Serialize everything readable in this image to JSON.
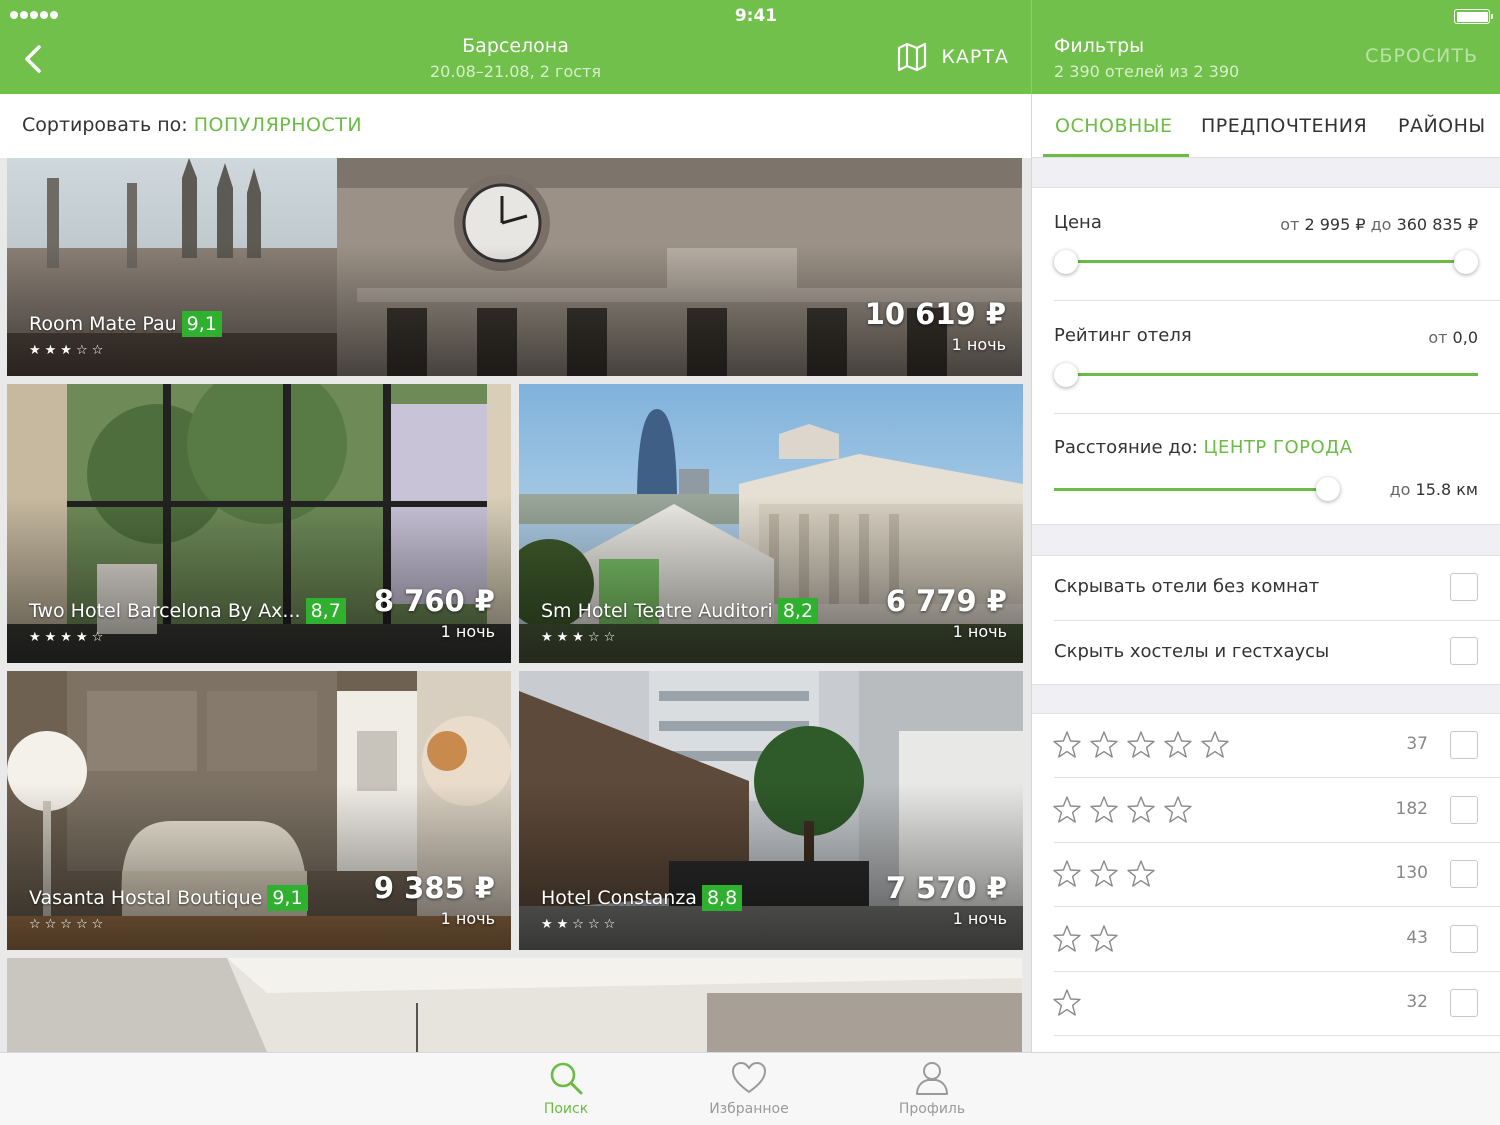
{
  "status": {
    "time": "9:41"
  },
  "header": {
    "city": "Барселона",
    "dates": "20.08–21.08, 2 гостя",
    "map_label": "КАРТА"
  },
  "filters_header": {
    "title": "Фильтры",
    "subtitle": "2 390 отелей из 2 390",
    "reset_label": "СБРОСИТЬ"
  },
  "sort": {
    "label": "Сортировать по:",
    "value": "ПОПУЛЯРНОСТИ"
  },
  "hotels": [
    {
      "name": "Room Mate Pau",
      "rating": "9,1",
      "stars": "★★★☆☆",
      "price": "10 619 ₽",
      "per": "1 ночь"
    },
    {
      "name": "Two Hotel Barcelona By Ax...",
      "rating": "8,7",
      "stars": "★★★★☆",
      "price": "8 760 ₽",
      "per": "1 ночь"
    },
    {
      "name": "Sm Hotel Teatre Auditori",
      "rating": "8,2",
      "stars": "★★★☆☆",
      "price": "6 779 ₽",
      "per": "1 ночь"
    },
    {
      "name": "Vasanta Hostal Boutique",
      "rating": "9,1",
      "stars": "☆☆☆☆☆",
      "price": "9 385 ₽",
      "per": "1 ночь"
    },
    {
      "name": "Hotel Constanza",
      "rating": "8,8",
      "stars": "★★☆☆☆",
      "price": "7 570 ₽",
      "per": "1 ночь"
    }
  ],
  "filter_tabs": {
    "main": "ОСНОВНЫЕ",
    "prefs": "ПРЕДПОЧТЕНИЯ",
    "districts": "РАЙОНЫ"
  },
  "price_filter": {
    "label": "Цена",
    "from_word": "от",
    "from": "2 995 ₽",
    "to_word": "до",
    "to": "360 835 ₽",
    "min_fraction": 0.0,
    "max_fraction": 1.0
  },
  "rating_filter": {
    "label": "Рейтинг отеля",
    "from_word": "от",
    "value": "0,0",
    "fraction": 0.0
  },
  "distance_filter": {
    "label": "Расстояние до:",
    "target": "ЦЕНТР ГОРОДА",
    "to_word": "до",
    "value": "15.8 км",
    "fraction": 1.0
  },
  "options": {
    "hide_no_rooms": "Скрывать отели без комнат",
    "hide_hostels": "Скрыть хостелы и гестхаусы"
  },
  "star_filters": [
    {
      "stars": 5,
      "count": "37"
    },
    {
      "stars": 4,
      "count": "182"
    },
    {
      "stars": 3,
      "count": "130"
    },
    {
      "stars": 2,
      "count": "43"
    },
    {
      "stars": 1,
      "count": "32"
    }
  ],
  "tabbar": {
    "search": "Поиск",
    "favorites": "Избранное",
    "profile": "Профиль"
  },
  "colors": {
    "brand_green": "#72c04c",
    "accent_green": "#6cbb45",
    "rating_green": "#2fb12f"
  }
}
